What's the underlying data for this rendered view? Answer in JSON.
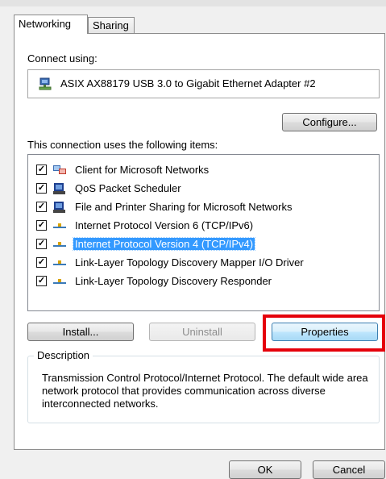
{
  "tabs": [
    {
      "label": "Networking",
      "active": true
    },
    {
      "label": "Sharing",
      "active": false
    }
  ],
  "connect_using_label": "Connect using:",
  "adapter": {
    "name": "ASIX AX88179 USB 3.0 to Gigabit Ethernet Adapter #2",
    "icon": "network-adapter-icon"
  },
  "configure_label": "Configure...",
  "items_label": "This connection uses the following items:",
  "items": [
    {
      "label": "Client for Microsoft Networks",
      "checked": true,
      "icon": "network-client-icon"
    },
    {
      "label": "QoS Packet Scheduler",
      "checked": true,
      "icon": "service-icon"
    },
    {
      "label": "File and Printer Sharing for Microsoft Networks",
      "checked": true,
      "icon": "service-icon"
    },
    {
      "label": "Internet Protocol Version 6 (TCP/IPv6)",
      "checked": true,
      "icon": "protocol-icon"
    },
    {
      "label": "Internet Protocol Version 4 (TCP/IPv4)",
      "checked": true,
      "icon": "protocol-icon",
      "selected": true
    },
    {
      "label": "Link-Layer Topology Discovery Mapper I/O Driver",
      "checked": true,
      "icon": "protocol-icon"
    },
    {
      "label": "Link-Layer Topology Discovery Responder",
      "checked": true,
      "icon": "protocol-icon"
    }
  ],
  "buttons": {
    "install": "Install...",
    "uninstall": "Uninstall",
    "properties": "Properties",
    "ok": "OK",
    "cancel": "Cancel"
  },
  "description": {
    "title": "Description",
    "text": "Transmission Control Protocol/Internet Protocol. The default wide area network protocol that provides communication across diverse interconnected networks."
  },
  "colors": {
    "selection": "#3399ff",
    "highlight_box": "#e5000b"
  }
}
